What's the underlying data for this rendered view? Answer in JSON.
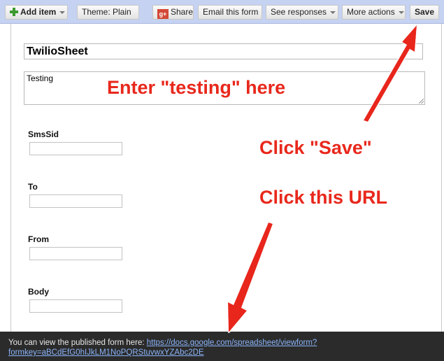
{
  "toolbar": {
    "add_item": "Add item",
    "theme_label": "Theme:  Plain",
    "share": "Share",
    "gplus_icon_text": "g+",
    "email": "Email this form",
    "see_responses": "See responses",
    "more_actions": "More actions",
    "save": "Save"
  },
  "form": {
    "title_value": "TwilioSheet",
    "description_value": "Testing",
    "questions": [
      {
        "label": "SmsSid"
      },
      {
        "label": "To"
      },
      {
        "label": "From"
      },
      {
        "label": "Body"
      }
    ]
  },
  "annotations": {
    "enter_testing": "Enter \"testing\" here",
    "click_save": "Click \"Save\"",
    "click_url": "Click this URL",
    "color": "#e8281c"
  },
  "bottom_bar": {
    "text": "You can view the published form here: ",
    "url_line1": "https://docs.google.com/spreadsheet/viewform?",
    "url_line2": "formkey=aBCdEfG0hIJkLM1NoPQRStuvwxYZAbc2DE"
  }
}
